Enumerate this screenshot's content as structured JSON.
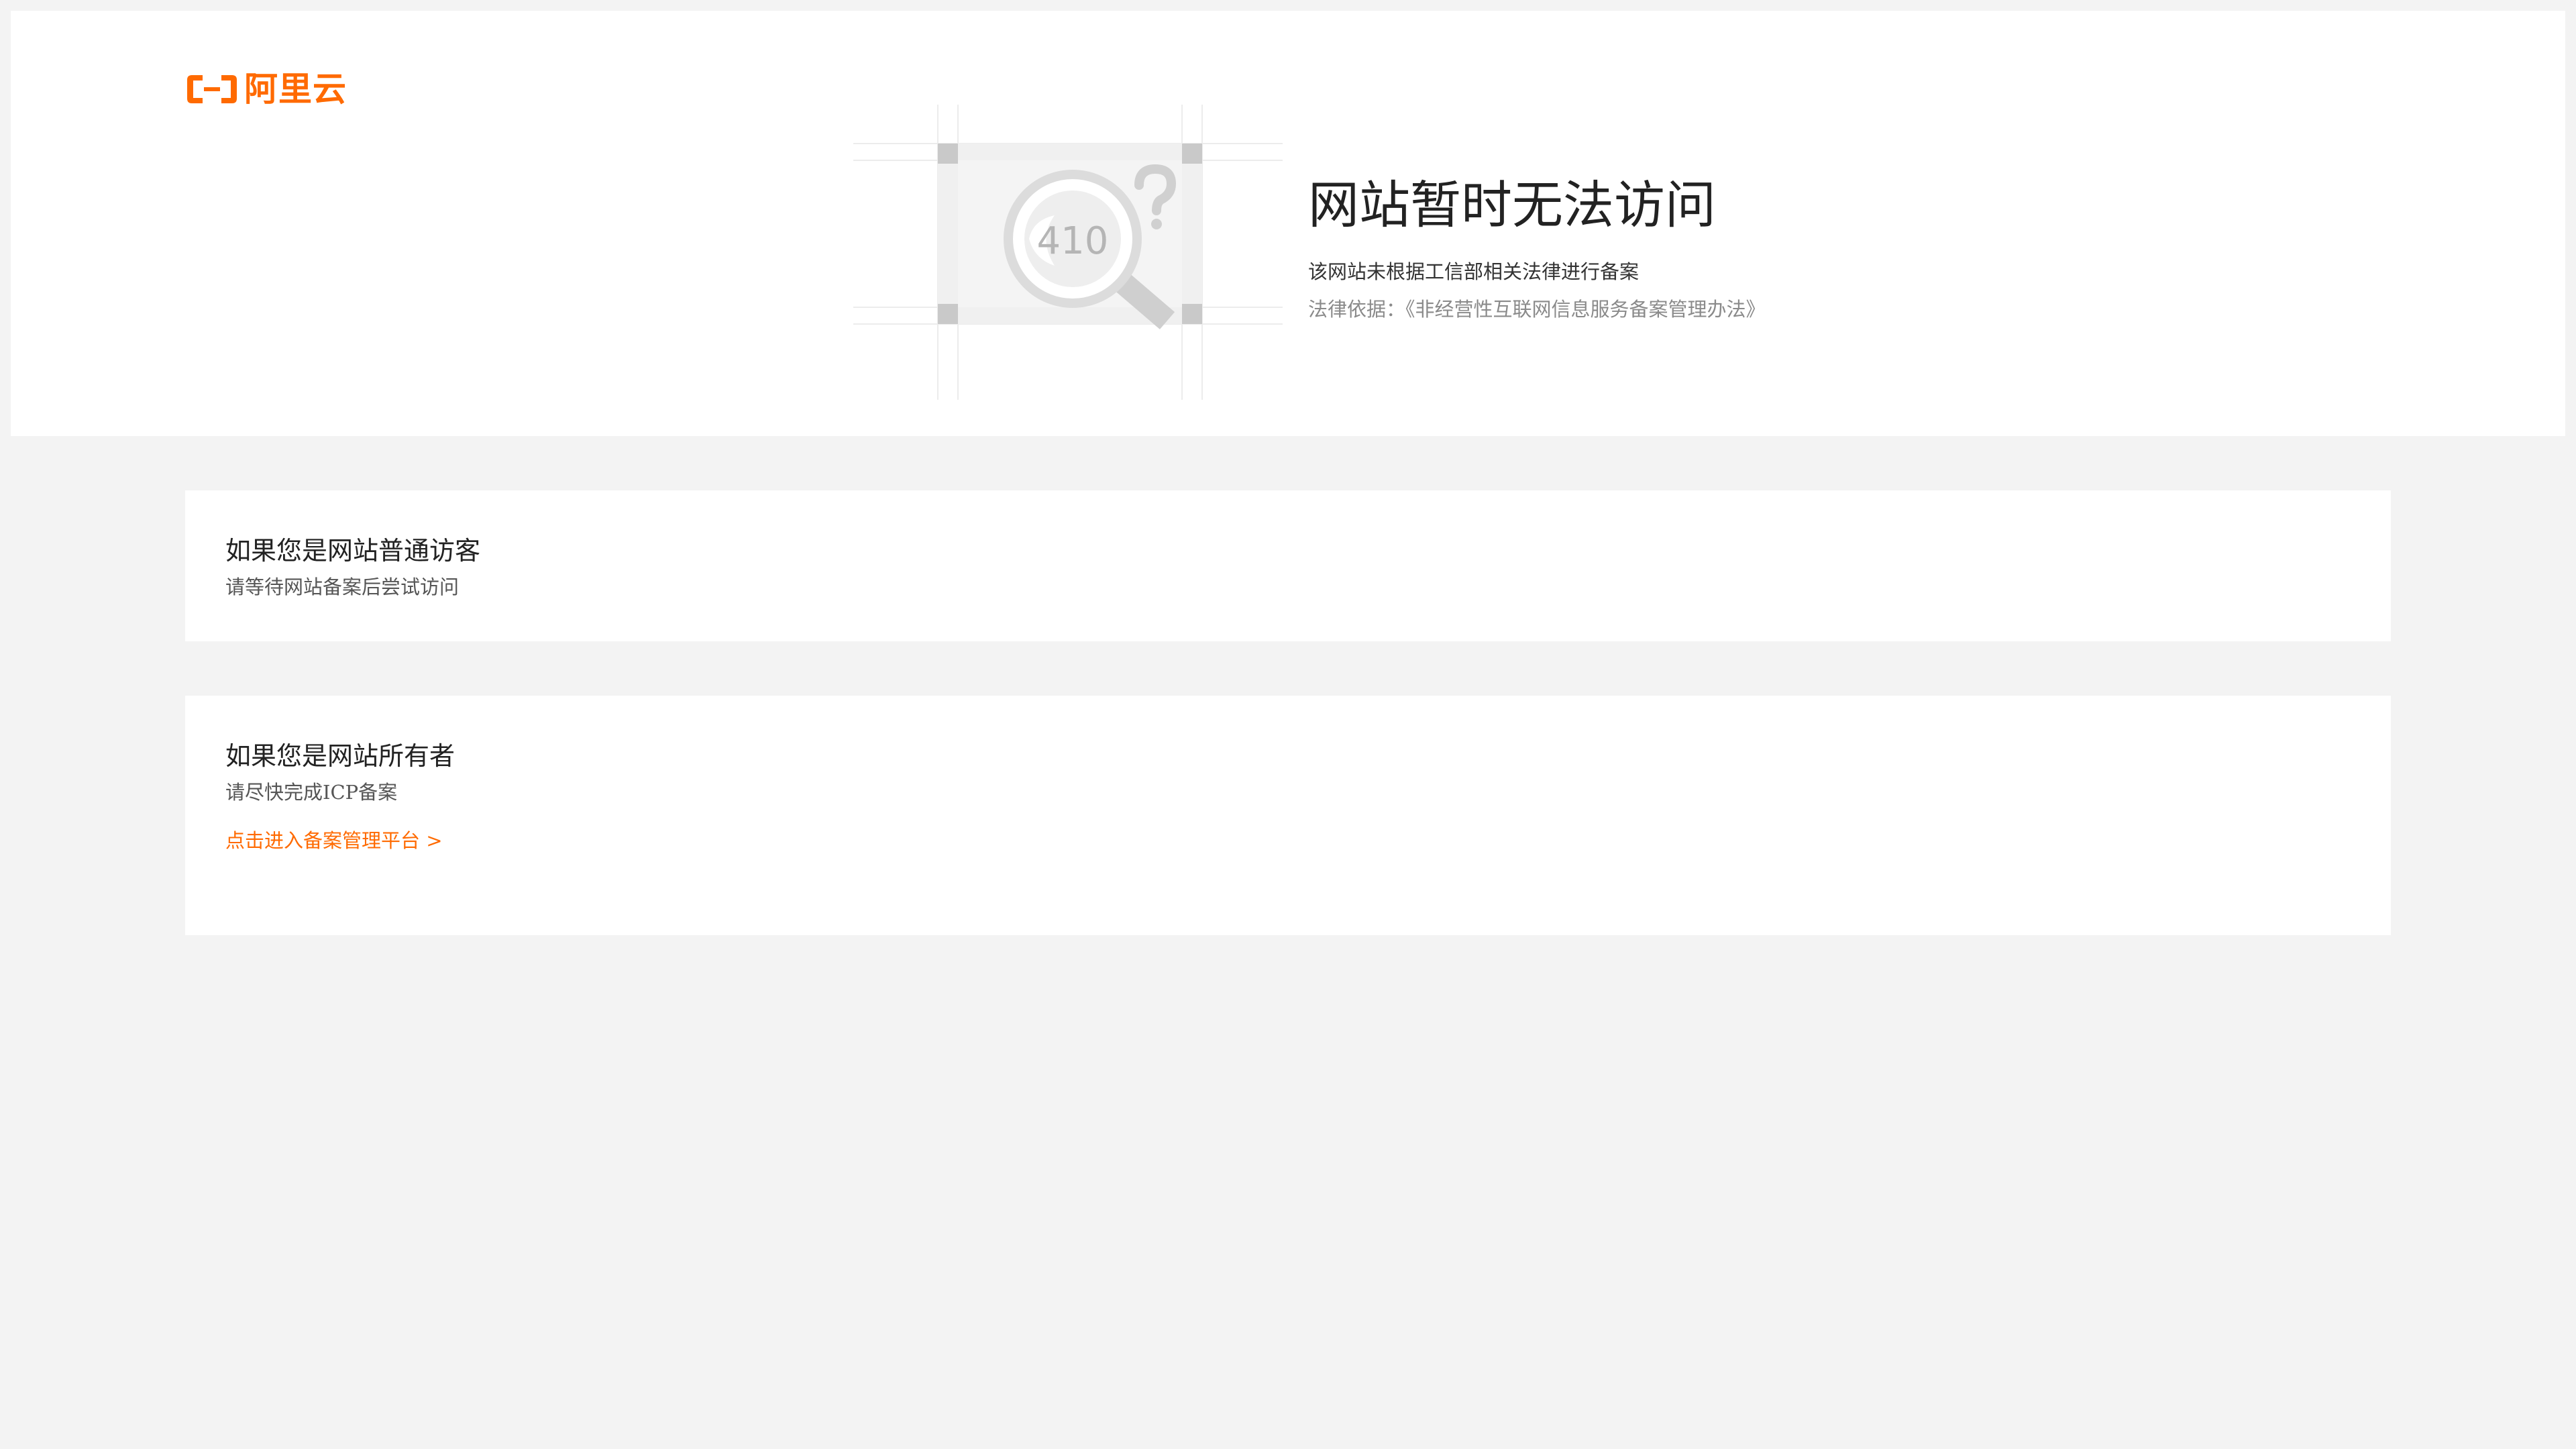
{
  "brand": {
    "logo_text": "阿里云",
    "accent_color": "#ff6a00",
    "logo_icon": "aliyun-bracket-icon"
  },
  "hero": {
    "illustration_icon": "magnifier-question-icon",
    "error_code": "410",
    "title": "网站暂时无法访问",
    "description": "该网站未根据工信部相关法律进行备案",
    "legal_basis": "法律依据：《非经营性互联网信息服务备案管理办法》"
  },
  "visitor_card": {
    "title": "如果您是网站普通访客",
    "description": "请等待网站备案后尝试访问"
  },
  "owner_card": {
    "title": "如果您是网站所有者",
    "description": "请尽快完成ICP备案",
    "link_label": "点击进入备案管理平台 >"
  }
}
